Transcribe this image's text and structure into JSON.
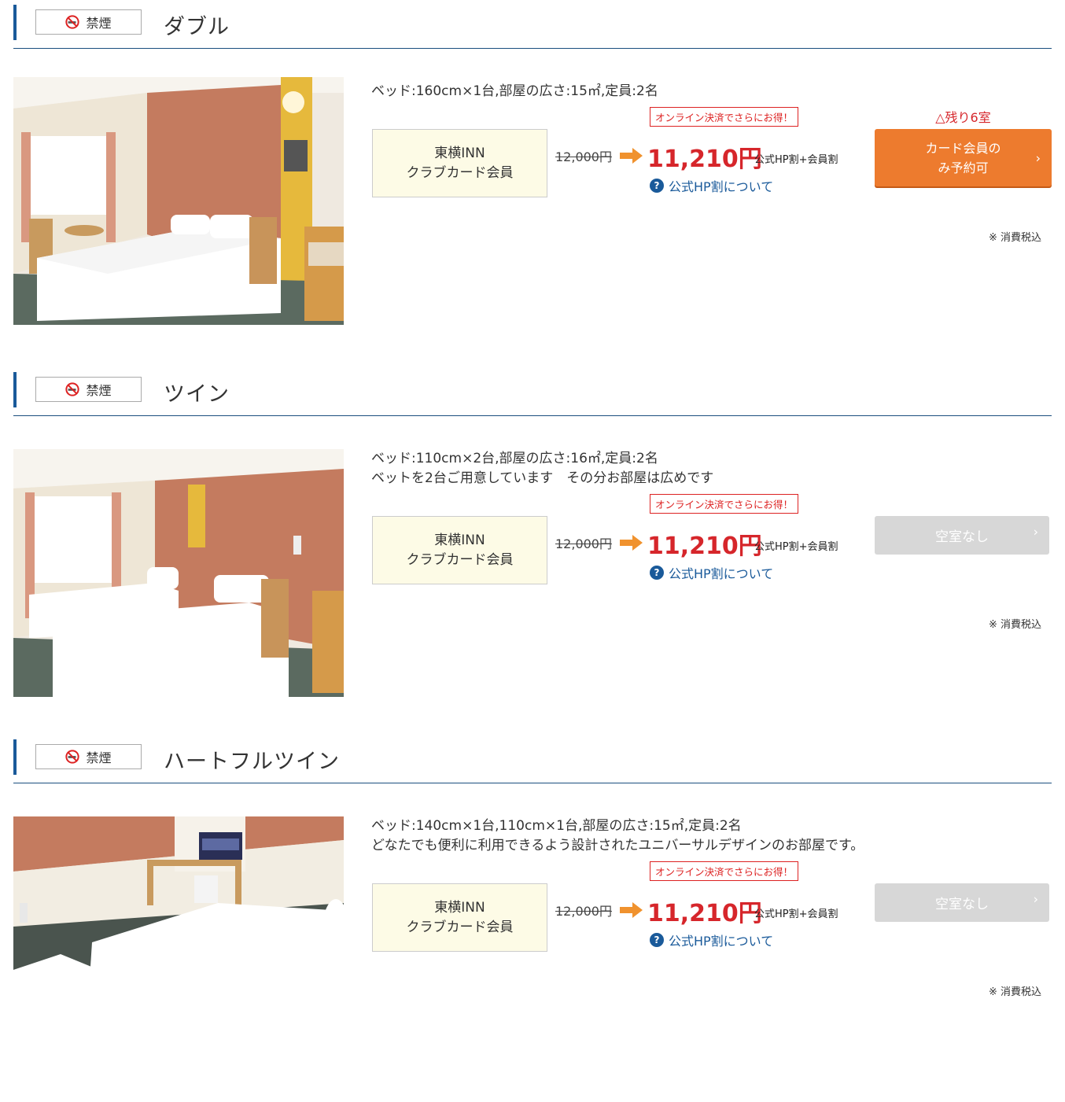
{
  "common": {
    "smoking_label": "禁煙",
    "plan_line1": "東横INN",
    "plan_line2": "クラブカード会員",
    "promo_badge": "オンライン決済でさらにお得！",
    "original_price": "12,000円",
    "sale_price": "11,210円",
    "discount_note": "公式HP割+会員割",
    "about_link": "公式HP割について",
    "tax_note": "※ 消費税込",
    "colors": {
      "accent_blue": "#1a5a9a",
      "price_red": "#d6262b",
      "book_orange": "#ed7b2e",
      "plan_bg": "#fdfbe6"
    }
  },
  "rooms": [
    {
      "name": "ダブル",
      "desc_line1": "ベッド:160cm×1台,部屋の広さ:15㎡,定員:2名",
      "desc_line2": "",
      "remaining": "△残り6室",
      "button_line1": "カード会員の",
      "button_line2": "み予約可",
      "available": true,
      "photo": "double-room-photo"
    },
    {
      "name": "ツイン",
      "desc_line1": "ベッド:110cm×2台,部屋の広さ:16㎡,定員:2名",
      "desc_line2": "ベットを2台ご用意しています　その分お部屋は広めです",
      "remaining": "",
      "button_label": "空室なし",
      "available": false,
      "photo": "twin-room-photo"
    },
    {
      "name": "ハートフルツイン",
      "desc_line1": "ベッド:140cm×1台,110cm×1台,部屋の広さ:15㎡,定員:2名",
      "desc_line2": "どなたでも便利に利用できるよう設計されたユニバーサルデザインのお部屋です。",
      "remaining": "",
      "button_label": "空室なし",
      "available": false,
      "photo": "heartful-twin-room-photo"
    }
  ]
}
